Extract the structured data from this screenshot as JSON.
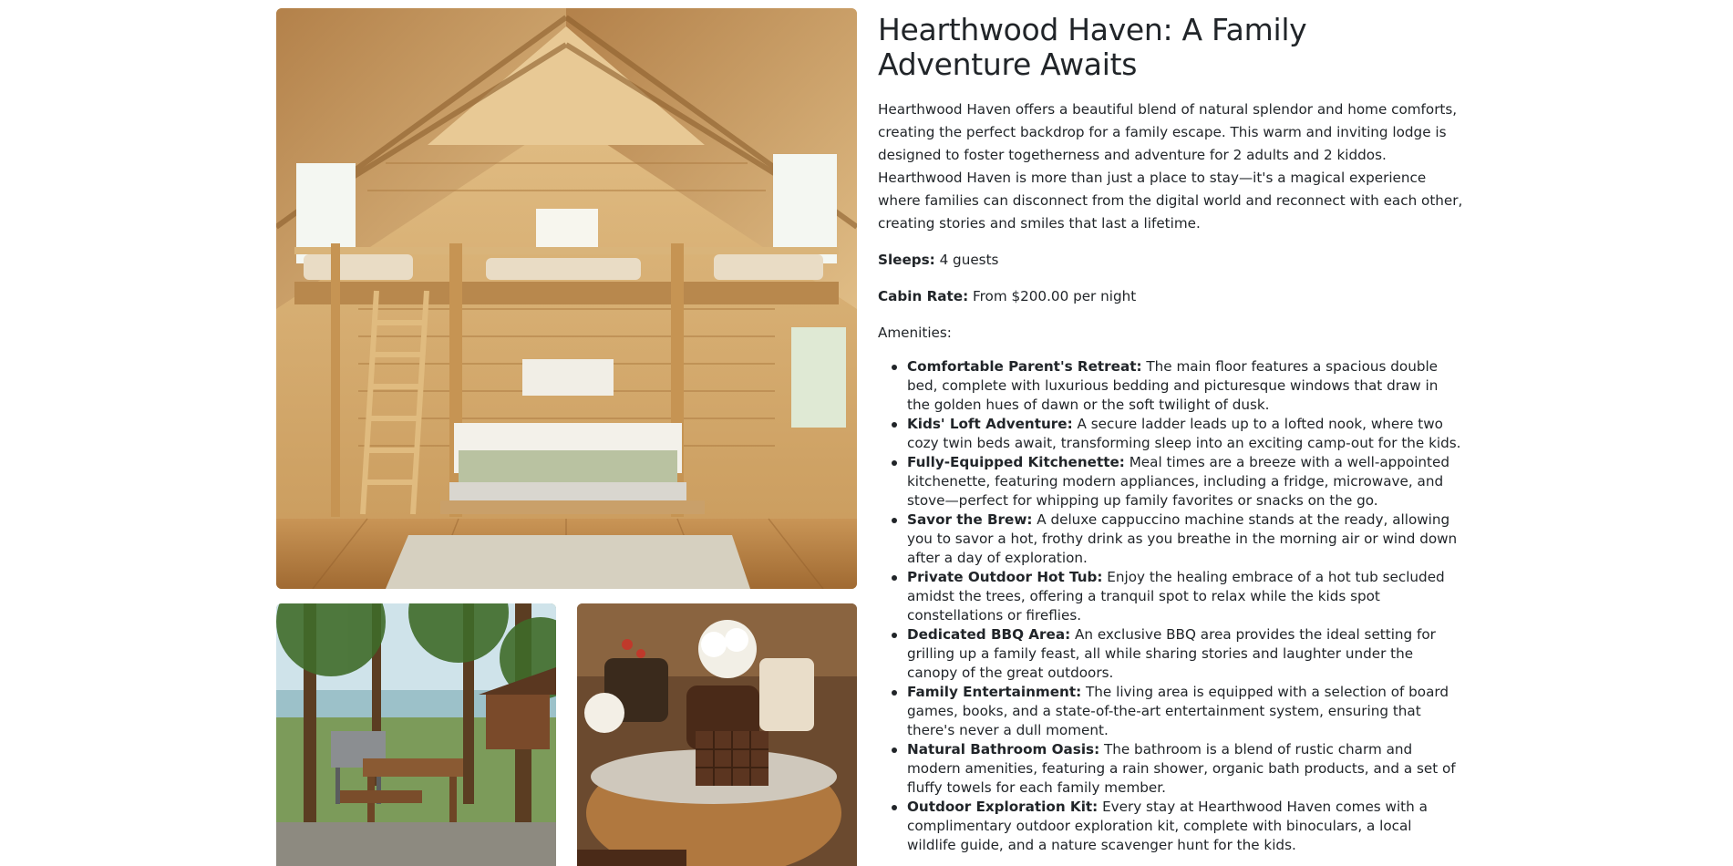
{
  "listing": {
    "title": "Hearthwood Haven: A Family Adventure Awaits",
    "description": "Hearthwood Haven offers a beautiful blend of natural splendor and home comforts, creating the perfect backdrop for a family escape. This warm and inviting lodge is designed to foster togetherness and adventure for 2 adults and 2 kiddos. Hearthwood Haven is more than just a place to stay—it's a magical experience where families can disconnect from the digital world and reconnect with each other, creating stories and smiles that last a lifetime.",
    "sleeps_label": "Sleeps:",
    "sleeps_value": "4 guests",
    "rate_label": "Cabin Rate:",
    "rate_value": "From $200.00 per night",
    "amenities_label": "Amenities:",
    "amenities": [
      {
        "name": "Comfortable Parent's Retreat:",
        "text": "The main floor features a spacious double bed, complete with luxurious bedding and picturesque windows that draw in the golden hues of dawn or the soft twilight of dusk."
      },
      {
        "name": "Kids' Loft Adventure:",
        "text": "A secure ladder leads up to a lofted nook, where two cozy twin beds await, transforming sleep into an exciting camp-out for the kids."
      },
      {
        "name": "Fully-Equipped Kitchenette:",
        "text": "Meal times are a breeze with a well-appointed kitchenette, featuring modern appliances, including a fridge, microwave, and stove—perfect for whipping up family favorites or snacks on the go."
      },
      {
        "name": "Savor the Brew:",
        "text": "A deluxe cappuccino machine stands at the ready, allowing you to savor a hot, frothy drink as you breathe in the morning air or wind down after a day of exploration."
      },
      {
        "name": "Private Outdoor Hot Tub:",
        "text": "Enjoy the healing embrace of a hot tub secluded amidst the trees, offering a tranquil spot to relax while the kids spot constellations or fireflies."
      },
      {
        "name": "Dedicated BBQ Area:",
        "text": "An exclusive BBQ area provides the ideal setting for grilling up a family feast, all while sharing stories and laughter under the canopy of the great outdoors."
      },
      {
        "name": "Family Entertainment:",
        "text": "The living area is equipped with a selection of board games, books, and a state-of-the-art entertainment system, ensuring that there's never a dull moment."
      },
      {
        "name": "Natural Bathroom Oasis:",
        "text": "The bathroom is a blend of rustic charm and modern amenities, featuring a rain shower, organic bath products, and a set of fluffy towels for each family member."
      },
      {
        "name": "Outdoor Exploration Kit:",
        "text": "Every stay at Hearthwood Haven comes with a complimentary outdoor exploration kit, complete with binoculars, a local wildlife guide, and a nature scavenger hunt for the kids."
      }
    ]
  },
  "photos": {
    "main": "cabin-interior-photo",
    "bbq": "bbq-area-photo",
    "smores": "smores-basket-photo"
  },
  "colors": {
    "text": "#212529",
    "wood_light": "#d9b47a",
    "wood_dark": "#a8773e"
  }
}
